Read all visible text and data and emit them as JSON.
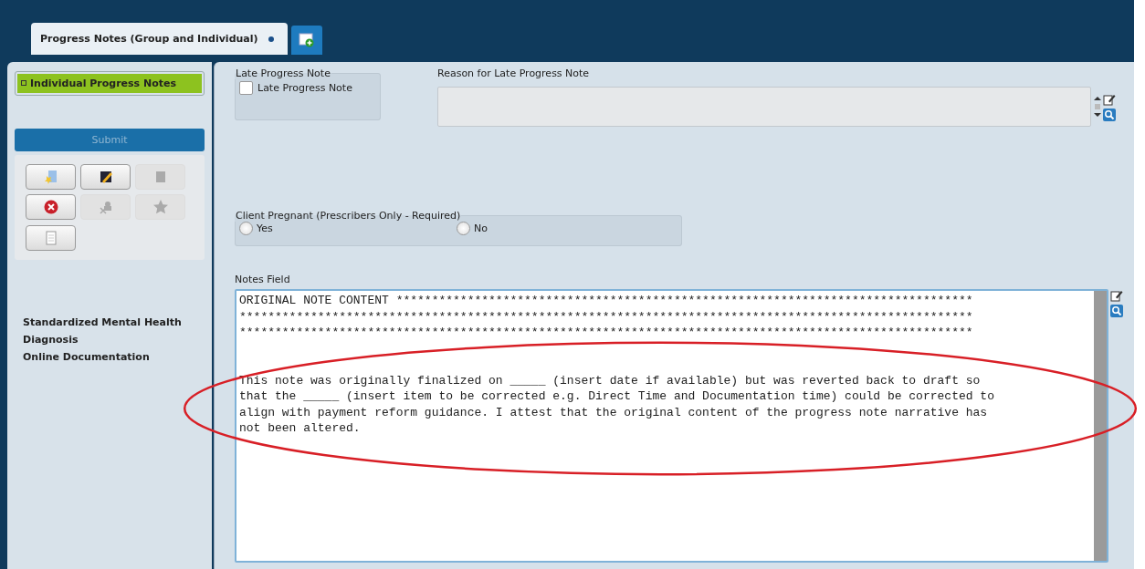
{
  "tabs": [
    {
      "label": "Progress Notes (Group and Individual)",
      "selected": true
    }
  ],
  "form_selector": {
    "label": "Individual Progress Notes",
    "selected": true
  },
  "submit_button": {
    "label": "Submit",
    "disabled": true
  },
  "toolbar": [
    {
      "disabled": false
    },
    {
      "disabled": false
    },
    {
      "disabled": true
    },
    {
      "disabled": false
    },
    {
      "disabled": true
    },
    {
      "disabled": true
    },
    {
      "disabled": false
    }
  ],
  "sidebar_links": [
    {
      "label": "Standardized Mental Health"
    },
    {
      "label": "Diagnosis"
    },
    {
      "label": "Online Documentation"
    }
  ],
  "late_note": {
    "group_label": "Late Progress Note",
    "checkbox_label": "Late Progress Note",
    "checked": false
  },
  "reason": {
    "label": "Reason for Late Progress Note"
  },
  "pregnant": {
    "group_label": "Client Pregnant (Prescribers Only - Required)",
    "options": [
      {
        "label": "Yes",
        "selected": false
      },
      {
        "label": "No",
        "selected": false
      }
    ]
  },
  "notes": {
    "label": "Notes Field",
    "lines": [
      "ORIGINAL NOTE CONTENT *********************************************************************************",
      "*******************************************************************************************************",
      "*******************************************************************************************************",
      "This note was originally finalized on _____ (insert date if available) but was reverted back to draft so",
      "that the _____ (insert item to be corrected e.g. Direct Time and Documentation time) could be corrected to",
      "align with payment reform guidance. I attest that the original content of the progress note narrative has",
      "not been altered."
    ]
  }
}
